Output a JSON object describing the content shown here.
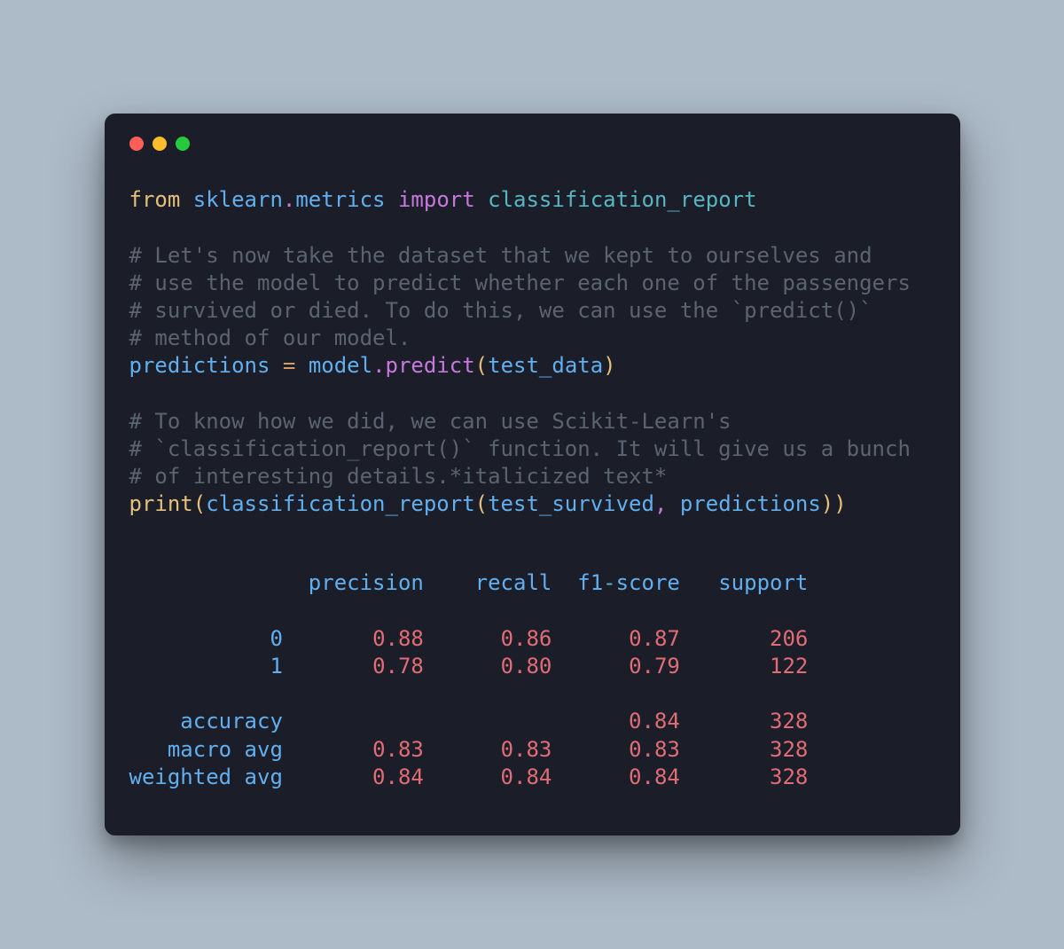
{
  "code": {
    "l1": {
      "from": "from",
      "sp1": " ",
      "mod1": "sklearn",
      "dot": ".",
      "mod2": "metrics",
      "sp2": " ",
      "import": "import",
      "sp3": " ",
      "name": "classification_report"
    },
    "c1": "# Let's now take the dataset that we kept to ourselves and",
    "c2": "# use the model to predict whether each one of the passengers",
    "c3": "# survived or died. To do this, we can use the `predict()`",
    "c4": "# method of our model.",
    "l2": {
      "var": "predictions",
      "sp1": " ",
      "eq": "=",
      "sp2": " ",
      "obj": "model",
      "dot": ".",
      "fn": "predict",
      "lp": "(",
      "arg": "test_data",
      "rp": ")"
    },
    "c5": "# To know how we did, we can use Scikit-Learn's",
    "c6": "# `classification_report()` function. It will give us a bunch",
    "c7": "# of interesting details.*italicized text*",
    "l3": {
      "print": "print",
      "lp1": "(",
      "fn": "classification_report",
      "lp2": "(",
      "arg1": "test_survived",
      "comma": ",",
      "sp": " ",
      "arg2": "predictions",
      "rp2": ")",
      "rp1": ")"
    }
  },
  "report": {
    "headers": {
      "precision": "precision",
      "recall": "recall",
      "f1a": "f1",
      "dash": "-",
      "f1b": "score",
      "support": "support"
    },
    "rows": [
      {
        "label": "0",
        "precision": "0.88",
        "recall": "0.86",
        "f1": "0.87",
        "support": "206"
      },
      {
        "label": "1",
        "precision": "0.78",
        "recall": "0.80",
        "f1": "0.79",
        "support": "122"
      }
    ],
    "summary": {
      "accuracy": {
        "label": "accuracy",
        "f1": "0.84",
        "support": "328"
      },
      "macro": {
        "label": "macro avg",
        "precision": "0.83",
        "recall": "0.83",
        "f1": "0.83",
        "support": "328"
      },
      "weighted": {
        "label": "weighted avg",
        "precision": "0.84",
        "recall": "0.84",
        "f1": "0.84",
        "support": "328"
      }
    }
  }
}
